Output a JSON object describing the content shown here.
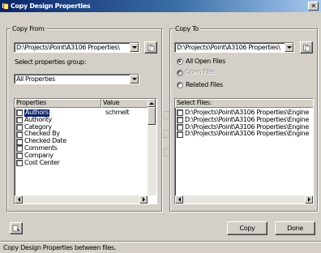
{
  "window": {
    "title": "Copy Design Properties",
    "close_glyph": "✕"
  },
  "copy_from": {
    "label": "Copy From",
    "file_value": "D:\\Projects\\Point\\A3106 Properties\\",
    "select_group_label": "Select properties group:",
    "group_value": "All Properties",
    "columns": [
      "Properties",
      "Value"
    ],
    "properties": [
      {
        "name": "Authors",
        "value": "schmelt",
        "checked": false,
        "selected": true
      },
      {
        "name": "Authority",
        "value": "",
        "checked": false,
        "selected": false
      },
      {
        "name": "Category",
        "value": "",
        "checked": false,
        "selected": false
      },
      {
        "name": "Checked By",
        "value": "",
        "checked": false,
        "selected": false
      },
      {
        "name": "Checked Date",
        "value": "",
        "checked": false,
        "selected": false
      },
      {
        "name": "Comments",
        "value": "",
        "checked": false,
        "selected": false
      },
      {
        "name": "Company",
        "value": "",
        "checked": false,
        "selected": false
      },
      {
        "name": "Cost Center",
        "value": "",
        "checked": false,
        "selected": false
      }
    ]
  },
  "copy_to": {
    "label": "Copy To",
    "file_value": "D:\\Projects\\Point\\A3106 Properties\\",
    "options": [
      {
        "label": "All Open Files",
        "state": "on"
      },
      {
        "label": "Open Files",
        "state": "disabled"
      },
      {
        "label": "Related Files",
        "state": "off"
      }
    ],
    "select_files_label": "Select Files:",
    "files": [
      "D:\\Projects\\Point\\A3106 Properties\\Engine",
      "D:\\Projects\\Point\\A3106 Properties\\Engine",
      "D:\\Projects\\Point\\A3106 Properties\\Engine",
      "D:\\Projects\\Point\\A3106 Properties\\Engine"
    ]
  },
  "buttons": {
    "copy": "Copy",
    "done": "Done"
  },
  "status": {
    "text": "Copy Design Properties between files."
  },
  "colors": {
    "title_bar": "#0a246a",
    "selection": "#0a246a",
    "face": "#d4d0c8"
  },
  "icons": {
    "title": "copy-design-app-icon",
    "browse": "folder-browse-icon",
    "help": "help-icon"
  }
}
